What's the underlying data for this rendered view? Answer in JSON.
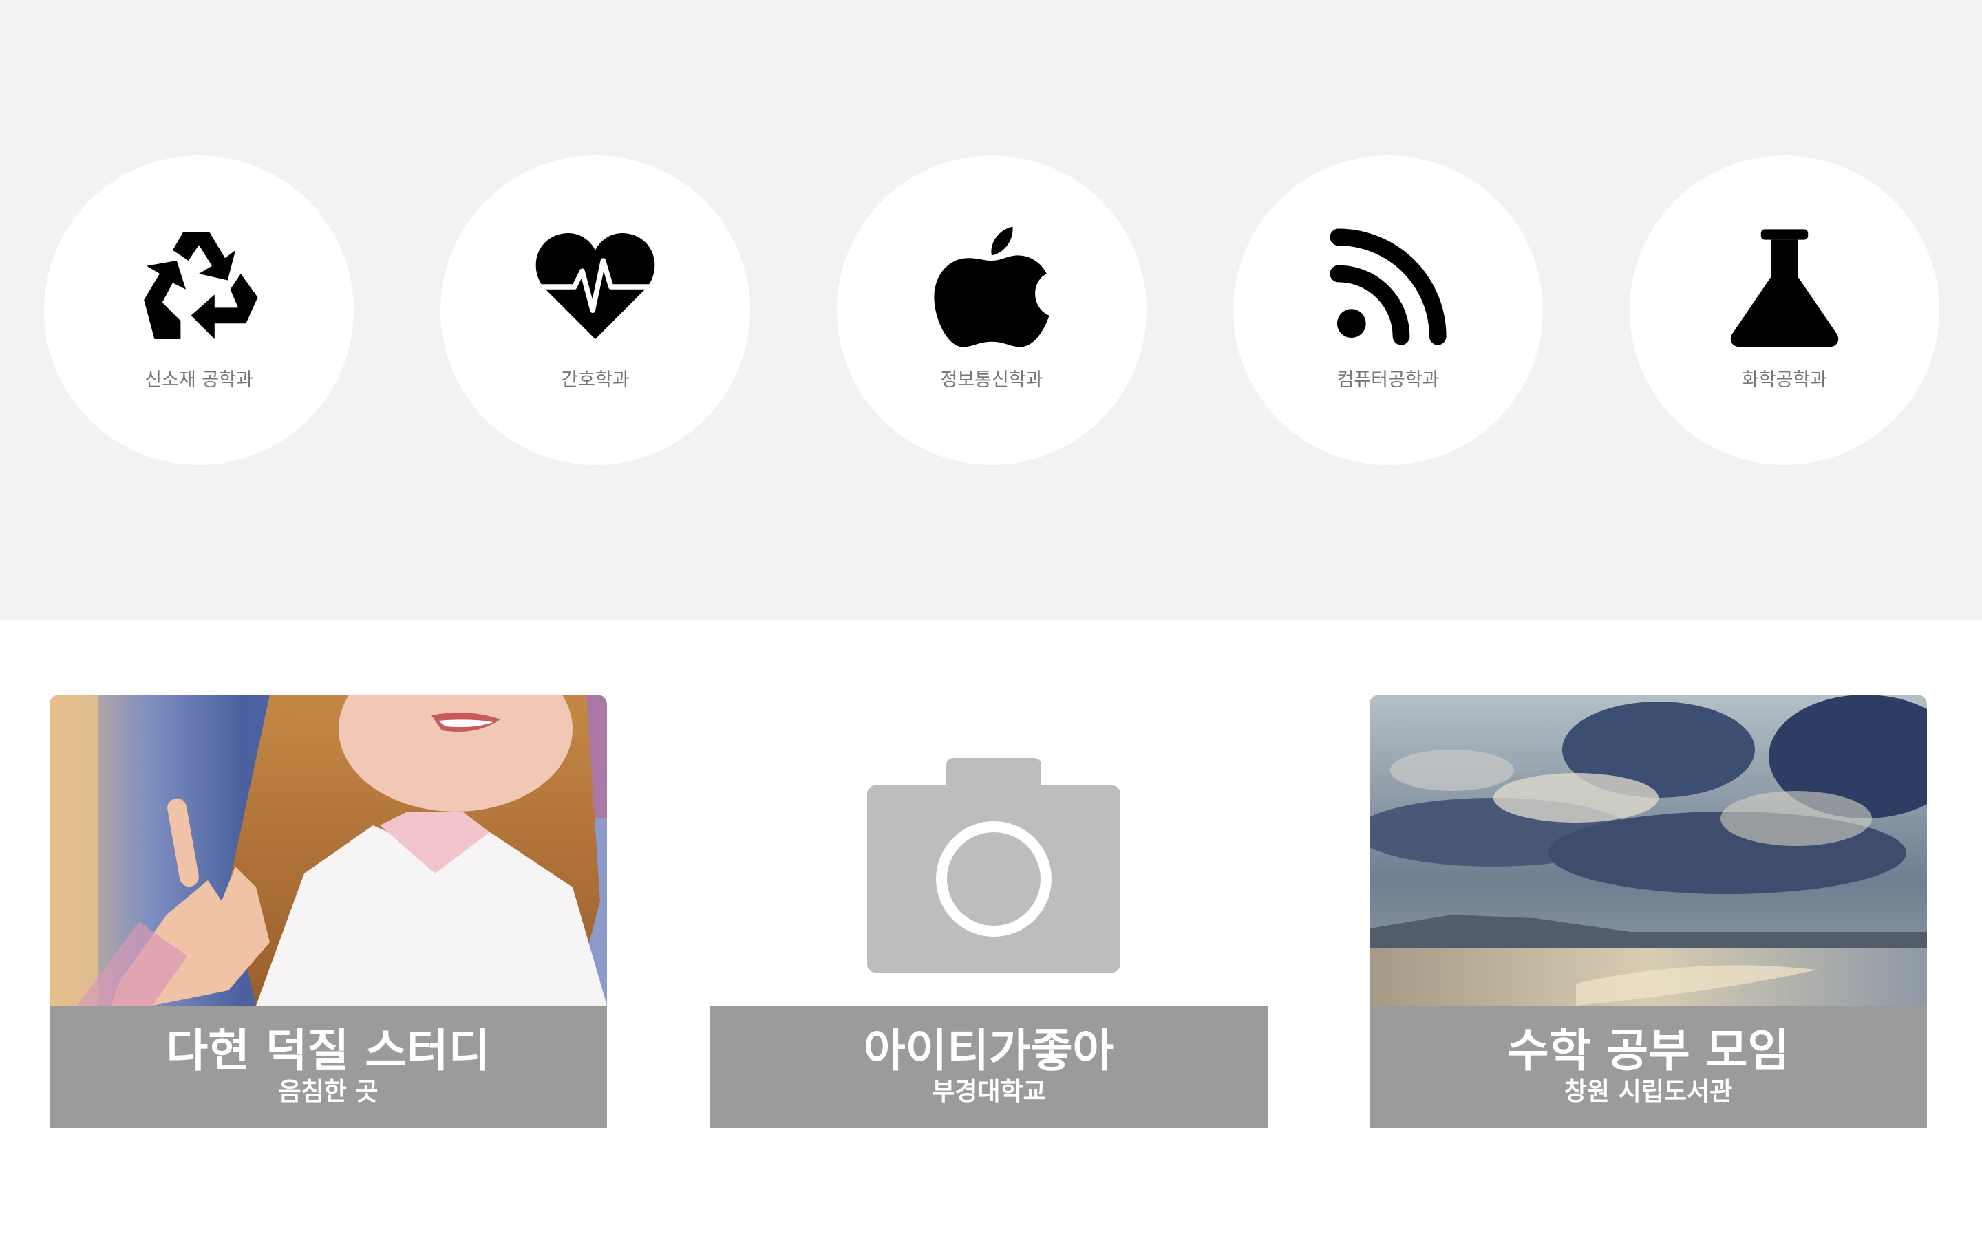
{
  "departments": [
    {
      "label": "신소재 공학과",
      "icon": "recycle-icon"
    },
    {
      "label": "간호학과",
      "icon": "heartbeat-icon"
    },
    {
      "label": "정보통신학과",
      "icon": "apple-icon"
    },
    {
      "label": "컴퓨터공학과",
      "icon": "rss-icon"
    },
    {
      "label": "화학공학과",
      "icon": "flask-icon"
    }
  ],
  "groups": [
    {
      "title": "다현 덕질 스터디",
      "location": "음침한 곳",
      "image": "performer-photo"
    },
    {
      "title": "아이티가좋아",
      "location": "부경대학교",
      "image": "camera-placeholder-icon"
    },
    {
      "title": "수학 공부 모임",
      "location": "창원 시립도서관",
      "image": "cloudy-beach-photo"
    }
  ],
  "colors": {
    "top_band": "#f1f2f4",
    "circle": "#ffffff",
    "icon": "#000000",
    "caption_bg": "#9b9b9b",
    "placeholder": "#bdbdbd"
  }
}
